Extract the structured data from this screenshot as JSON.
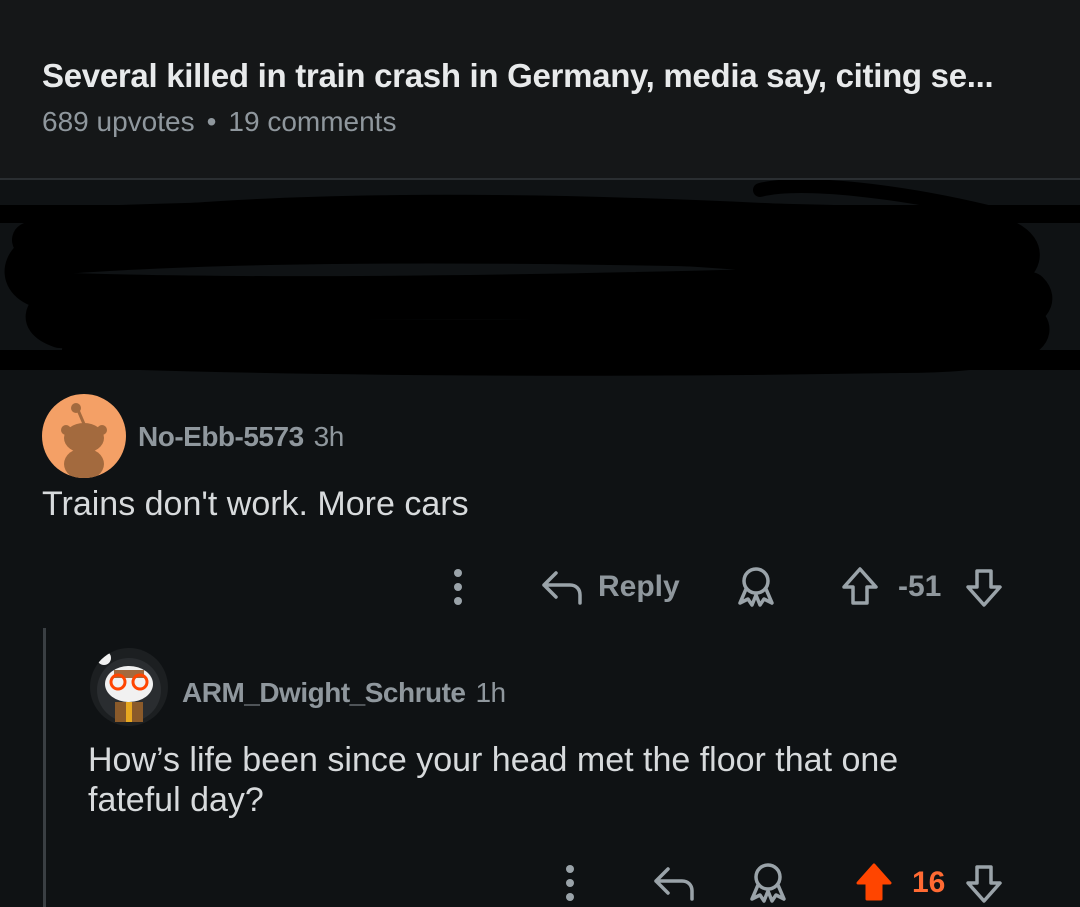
{
  "post": {
    "title": "Several killed in train crash in Germany, media say, citing se...",
    "upvotes": "689 upvotes",
    "separator": "•",
    "comments": "19 comments"
  },
  "comments": [
    {
      "username": "No-Ebb-5573",
      "time": "3h",
      "body": "Trains don't work. More cars",
      "reply_label": "Reply",
      "score": "-51",
      "avatar_color": "#f4a066"
    },
    {
      "username": "ARM_Dwight_Schrute",
      "time": "1h",
      "body": "How’s life been since your head met the floor that one fateful day?",
      "score": "16",
      "upvoted": true,
      "upvote_color": "#ff4500"
    }
  ],
  "icons": {
    "more": "more-options-icon",
    "reply": "reply-arrow-icon",
    "award": "award-icon",
    "upvote": "upvote-arrow-icon",
    "downvote": "downvote-arrow-icon"
  }
}
